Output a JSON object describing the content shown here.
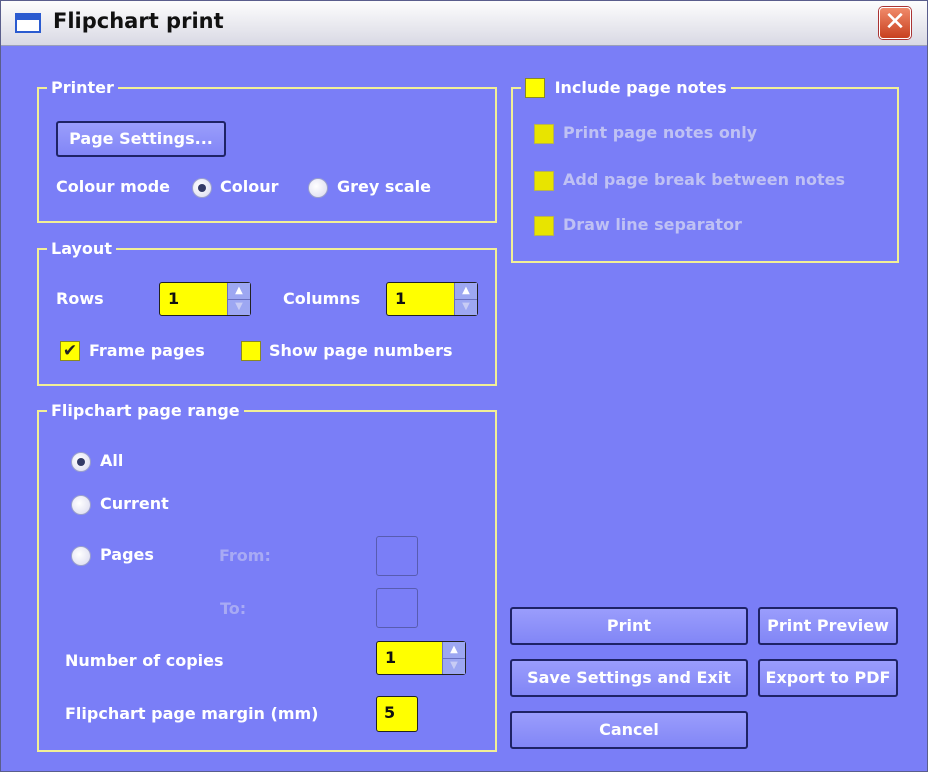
{
  "window": {
    "title": "Flipchart print",
    "close_label": "✕"
  },
  "printer": {
    "legend": "Printer",
    "page_settings_label": "Page Settings...",
    "colour_mode_label": "Colour mode",
    "colour_option": "Colour",
    "grey_option": "Grey scale",
    "selected": "Colour"
  },
  "layout": {
    "legend": "Layout",
    "rows_label": "Rows",
    "rows_value": "1",
    "columns_label": "Columns",
    "columns_value": "1",
    "frame_pages_label": "Frame pages",
    "frame_pages_checked": true,
    "show_page_numbers_label": "Show page numbers",
    "show_page_numbers_checked": false
  },
  "range": {
    "legend": "Flipchart page range",
    "all_label": "All",
    "current_label": "Current",
    "pages_label": "Pages",
    "from_label": "From:",
    "to_label": "To:",
    "from_value": "",
    "to_value": "",
    "selected": "All",
    "copies_label": "Number of copies",
    "copies_value": "1",
    "margin_label": "Flipchart page margin (mm)",
    "margin_value": "5"
  },
  "notes": {
    "legend": "Include page notes",
    "legend_checked": false,
    "print_only_label": "Print page notes only",
    "page_break_label": "Add page break between notes",
    "line_separator_label": "Draw line separator"
  },
  "actions": {
    "print_label": "Print",
    "print_preview_label": "Print Preview",
    "save_exit_label": "Save Settings and Exit",
    "export_pdf_label": "Export to PDF",
    "cancel_label": "Cancel"
  },
  "colors": {
    "background": "#7a7ef7",
    "frame": "#f2ef96",
    "field": "#ffff00"
  }
}
